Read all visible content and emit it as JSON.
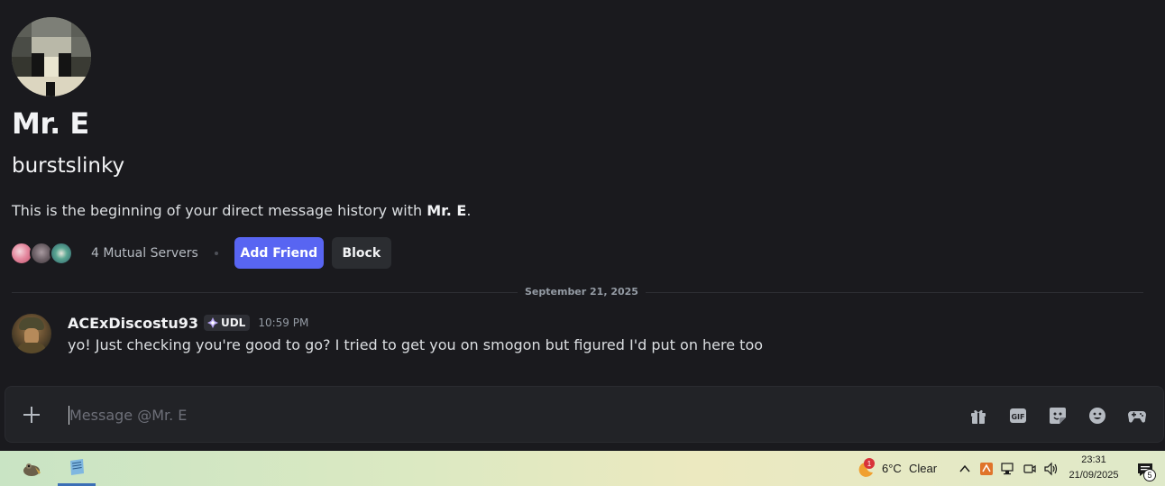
{
  "profile": {
    "display_name": "Mr. E",
    "username": "burstslinky",
    "intro_prefix": "This is the beginning of your direct message history with ",
    "intro_name": "Mr. E",
    "intro_suffix": "."
  },
  "mutual": {
    "text": "4 Mutual Servers",
    "icons": [
      "server-icon-pink",
      "server-icon-gray",
      "server-icon-teal"
    ]
  },
  "actions": {
    "add_friend": "Add Friend",
    "block": "Block"
  },
  "divider": {
    "date": "September 21, 2025"
  },
  "message": {
    "author": "ACExDiscostu93",
    "tag": "UDL",
    "time": "10:59 PM",
    "text": "yo! Just checking you're good to go? I tried to get you on smogon but figured I'd put on here too"
  },
  "composer": {
    "placeholder": "Message @Mr. E",
    "icons": [
      "gift-icon",
      "gif-icon",
      "sticker-icon",
      "emoji-icon",
      "activity-icon"
    ]
  },
  "taskbar": {
    "weather_badge": "1",
    "weather_temp": "6°C",
    "weather_cond": "Clear",
    "time": "23:31",
    "date": "21/09/2025",
    "notification_count": "5"
  },
  "colors": {
    "background": "#1a1a1e",
    "accent": "#5865f2",
    "composer": "#222327"
  }
}
